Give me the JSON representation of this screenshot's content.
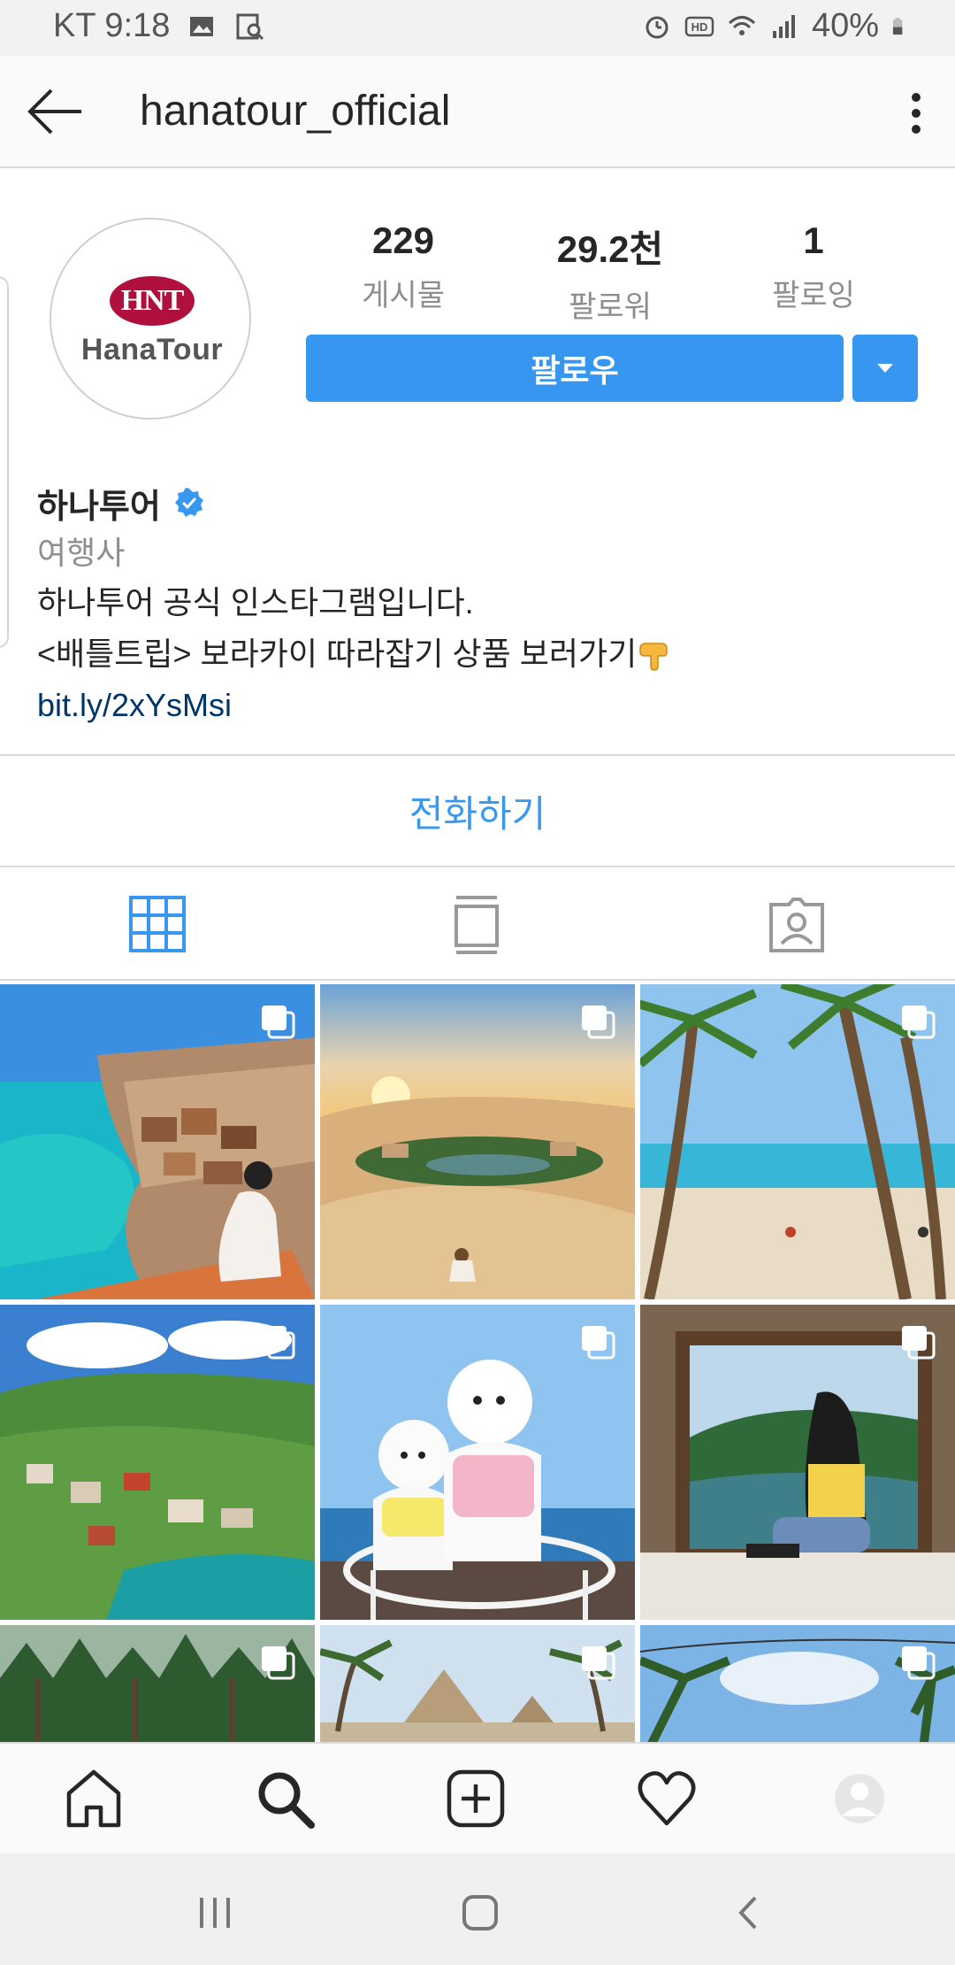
{
  "status_bar": {
    "carrier_time": "KT 9:18",
    "battery": "40%"
  },
  "header": {
    "username": "hanatour_official"
  },
  "profile": {
    "logo_text_oval": "HNT",
    "logo_text_brand": "HanaTour",
    "stats": [
      {
        "value": "229",
        "label": "게시물"
      },
      {
        "value": "29.2천",
        "label": "팔로워"
      },
      {
        "value": "1",
        "label": "팔로잉"
      }
    ],
    "follow_label": "팔로우",
    "name": "하나투어",
    "category": "여행사",
    "bio_line1": "하나투어 공식 인스타그램입니다.",
    "bio_line2": "<배틀트립> 보라카이 따라잡기 상품 보러가기",
    "link": "bit.ly/2xYsMsi",
    "contact_label": "전화하기"
  },
  "grid_posts": [
    {
      "subject": "coastal-village",
      "multi": true
    },
    {
      "subject": "desert-oasis",
      "multi": true
    },
    {
      "subject": "palm-beach",
      "multi": true
    },
    {
      "subject": "alpine-town",
      "multi": true
    },
    {
      "subject": "pomeranian-dogs",
      "multi": true
    },
    {
      "subject": "window-view",
      "multi": true
    },
    {
      "subject": "forest",
      "multi": true
    },
    {
      "subject": "pyramids",
      "multi": true
    },
    {
      "subject": "palms-sky",
      "multi": true
    }
  ],
  "colors": {
    "accent": "#3797f0",
    "brand": "#b0103d",
    "link": "#003569"
  }
}
